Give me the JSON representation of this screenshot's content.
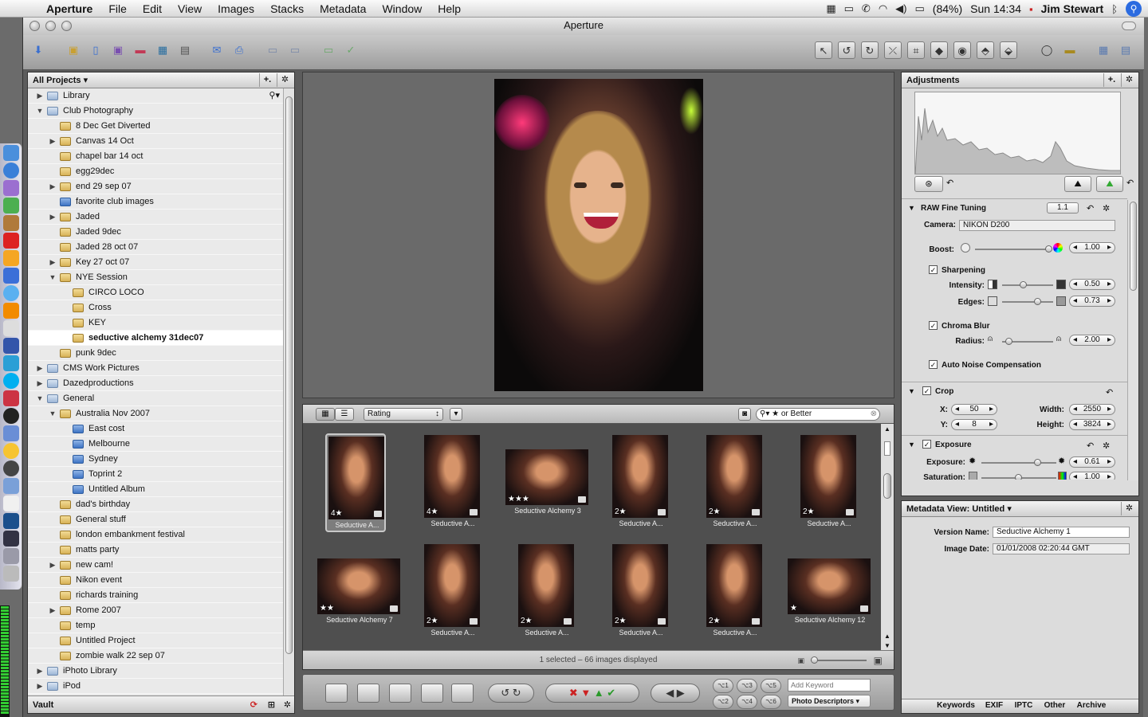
{
  "menubar": {
    "app": "Aperture",
    "menus": [
      "File",
      "Edit",
      "View",
      "Images",
      "Stacks",
      "Metadata",
      "Window",
      "Help"
    ],
    "battery": "(84%)",
    "clock": "Sun 14:34",
    "user": "Jim Stewart"
  },
  "window": {
    "title": "Aperture"
  },
  "projects": {
    "header": "All Projects ▾",
    "footer": "Vault",
    "items": [
      {
        "label": "Library",
        "level": 0,
        "tri": "▶",
        "icon": "folder"
      },
      {
        "label": "Club Photography",
        "level": 0,
        "tri": "▼",
        "icon": "folder"
      },
      {
        "label": "8 Dec Get Diverted",
        "level": 1,
        "tri": "",
        "icon": "proj"
      },
      {
        "label": "Canvas 14 Oct",
        "level": 1,
        "tri": "▶",
        "icon": "proj"
      },
      {
        "label": "chapel bar 14 oct",
        "level": 1,
        "tri": "",
        "icon": "proj"
      },
      {
        "label": "egg29dec",
        "level": 1,
        "tri": "",
        "icon": "proj"
      },
      {
        "label": "end 29 sep 07",
        "level": 1,
        "tri": "▶",
        "icon": "proj"
      },
      {
        "label": "favorite club images",
        "level": 1,
        "tri": "",
        "icon": "album"
      },
      {
        "label": "Jaded",
        "level": 1,
        "tri": "▶",
        "icon": "proj"
      },
      {
        "label": "Jaded 9dec",
        "level": 1,
        "tri": "",
        "icon": "proj"
      },
      {
        "label": "Jaded 28 oct 07",
        "level": 1,
        "tri": "",
        "icon": "proj"
      },
      {
        "label": "Key 27 oct 07",
        "level": 1,
        "tri": "▶",
        "icon": "proj"
      },
      {
        "label": "NYE Session",
        "level": 1,
        "tri": "▼",
        "icon": "proj"
      },
      {
        "label": "CIRCO LOCO",
        "level": 2,
        "tri": "",
        "icon": "proj"
      },
      {
        "label": "Cross",
        "level": 2,
        "tri": "",
        "icon": "proj"
      },
      {
        "label": "KEY",
        "level": 2,
        "tri": "",
        "icon": "proj"
      },
      {
        "label": "seductive alchemy 31dec07",
        "level": 2,
        "tri": "",
        "icon": "proj",
        "selected": true
      },
      {
        "label": "punk 9dec",
        "level": 1,
        "tri": "",
        "icon": "proj"
      },
      {
        "label": "CMS Work Pictures",
        "level": 0,
        "tri": "▶",
        "icon": "folder"
      },
      {
        "label": "Dazedproductions",
        "level": 0,
        "tri": "▶",
        "icon": "folder"
      },
      {
        "label": "General",
        "level": 0,
        "tri": "▼",
        "icon": "folder"
      },
      {
        "label": "Australia Nov 2007",
        "level": 1,
        "tri": "▼",
        "icon": "proj"
      },
      {
        "label": "East cost",
        "level": 2,
        "tri": "",
        "icon": "album"
      },
      {
        "label": "Melbourne",
        "level": 2,
        "tri": "",
        "icon": "album"
      },
      {
        "label": "Sydney",
        "level": 2,
        "tri": "",
        "icon": "album"
      },
      {
        "label": "Toprint 2",
        "level": 2,
        "tri": "",
        "icon": "album"
      },
      {
        "label": "Untitled Album",
        "level": 2,
        "tri": "",
        "icon": "album"
      },
      {
        "label": "dad's birthday",
        "level": 1,
        "tri": "",
        "icon": "proj"
      },
      {
        "label": "General stuff",
        "level": 1,
        "tri": "",
        "icon": "proj"
      },
      {
        "label": "london embankment festival",
        "level": 1,
        "tri": "",
        "icon": "proj"
      },
      {
        "label": "matts party",
        "level": 1,
        "tri": "",
        "icon": "proj"
      },
      {
        "label": "new cam!",
        "level": 1,
        "tri": "▶",
        "icon": "proj"
      },
      {
        "label": "Nikon event",
        "level": 1,
        "tri": "",
        "icon": "proj"
      },
      {
        "label": "richards training",
        "level": 1,
        "tri": "",
        "icon": "proj"
      },
      {
        "label": "Rome 2007",
        "level": 1,
        "tri": "▶",
        "icon": "proj"
      },
      {
        "label": "temp",
        "level": 1,
        "tri": "",
        "icon": "proj"
      },
      {
        "label": "Untitled Project",
        "level": 1,
        "tri": "",
        "icon": "proj"
      },
      {
        "label": "zombie walk 22 sep 07",
        "level": 1,
        "tri": "",
        "icon": "proj"
      },
      {
        "label": "iPhoto Library",
        "level": 0,
        "tri": "▶",
        "icon": "folder"
      },
      {
        "label": "iPod",
        "level": 0,
        "tri": "▶",
        "icon": "folder"
      }
    ]
  },
  "browser": {
    "sort": "Rating",
    "filter": "★ or Better",
    "status": "1 selected – 66 images displayed",
    "thumbs": [
      {
        "caption": "Seductive A...",
        "stars": "4★",
        "orient": "portrait",
        "selected": true
      },
      {
        "caption": "Seductive A...",
        "stars": "4★",
        "orient": "portrait"
      },
      {
        "caption": "Seductive Alchemy 3",
        "stars": "★★★",
        "orient": "landscape"
      },
      {
        "caption": "Seductive A...",
        "stars": "2★",
        "orient": "portrait"
      },
      {
        "caption": "Seductive A...",
        "stars": "2★",
        "orient": "portrait"
      },
      {
        "caption": "Seductive A...",
        "stars": "2★",
        "orient": "portrait"
      },
      {
        "caption": "Seductive Alchemy 7",
        "stars": "★★",
        "orient": "landscape"
      },
      {
        "caption": "Seductive A...",
        "stars": "2★",
        "orient": "portrait"
      },
      {
        "caption": "Seductive A...",
        "stars": "2★",
        "orient": "portrait"
      },
      {
        "caption": "Seductive A...",
        "stars": "2★",
        "orient": "portrait"
      },
      {
        "caption": "Seductive A...",
        "stars": "2★",
        "orient": "portrait"
      },
      {
        "caption": "Seductive Alchemy 12",
        "stars": "★",
        "orient": "landscape"
      }
    ]
  },
  "controls": {
    "keyword_placeholder": "Add Keyword",
    "keyword_set": "Photo Descriptors ▾",
    "kb": [
      "⌥1",
      "⌥3",
      "⌥5",
      "⌥2",
      "⌥4",
      "⌥6"
    ]
  },
  "adjustments": {
    "header": "Adjustments",
    "raw": {
      "title": "RAW Fine Tuning",
      "version": "1.1",
      "camera_label": "Camera:",
      "camera": "NIKON D200",
      "boost_label": "Boost:",
      "boost": "1.00",
      "sharpening": "Sharpening",
      "intensity_label": "Intensity:",
      "intensity": "0.50",
      "edges_label": "Edges:",
      "edges": "0.73",
      "chroma": "Chroma Blur",
      "radius_label": "Radius:",
      "radius": "2.00",
      "noise": "Auto Noise Compensation"
    },
    "crop": {
      "title": "Crop",
      "x_label": "X:",
      "x": "50",
      "y_label": "Y:",
      "y": "8",
      "width_label": "Width:",
      "width": "2550",
      "height_label": "Height:",
      "height": "3824"
    },
    "exposure": {
      "title": "Exposure",
      "exposure_label": "Exposure:",
      "exposure": "0.61",
      "saturation_label": "Saturation:",
      "saturation": "1.00"
    }
  },
  "metadata": {
    "header": "Metadata View: Untitled ▾",
    "version_label": "Version Name:",
    "version": "Seductive Alchemy 1",
    "date_label": "Image Date:",
    "date": "01/01/2008 02:20:44 GMT",
    "tabs": [
      "Keywords",
      "EXIF",
      "IPTC",
      "Other",
      "Archive"
    ]
  }
}
